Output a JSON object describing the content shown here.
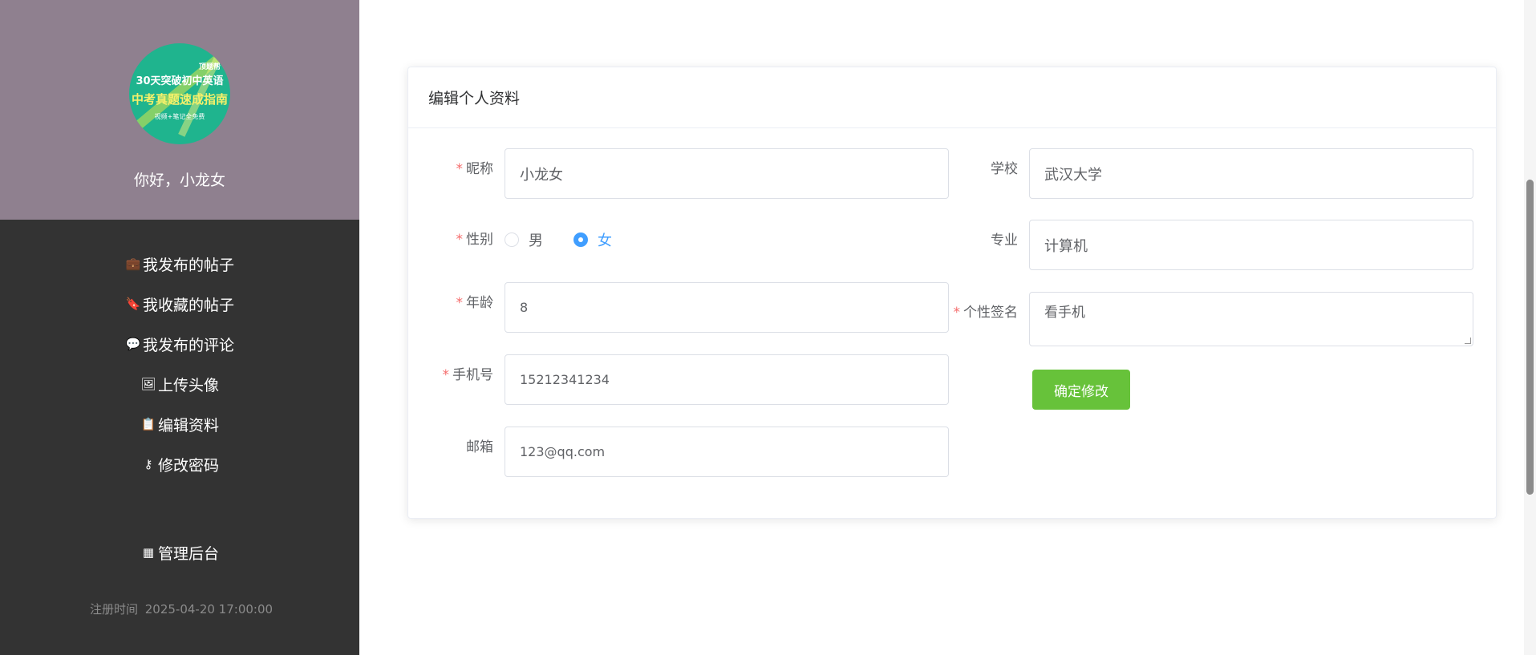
{
  "sidebar": {
    "avatar": {
      "line0": "顶题帮",
      "line1": "30天突破初中英语",
      "line2": "中考真题速成指南",
      "line3": "视频+笔记全免费"
    },
    "greeting": "你好，小龙女",
    "menu": [
      {
        "icon": "briefcase-icon",
        "label": "我发布的帖子"
      },
      {
        "icon": "bookmark-icon",
        "label": "我收藏的帖子"
      },
      {
        "icon": "comment-icon",
        "label": "我发布的评论"
      },
      {
        "icon": "image-icon",
        "label": "上传头像"
      },
      {
        "icon": "clipboard-icon",
        "label": "编辑资料"
      },
      {
        "icon": "key-icon",
        "label": "修改密码"
      }
    ],
    "admin": {
      "icon": "grid-icon",
      "label": "管理后台"
    },
    "register_label": "注册时间",
    "register_time": "2025-04-20 17:00:00"
  },
  "form": {
    "title": "编辑个人资料",
    "nickname": {
      "label": "昵称",
      "value": "小龙女",
      "required": true
    },
    "gender": {
      "label": "性别",
      "options": [
        "男",
        "女"
      ],
      "selected": "女",
      "required": true
    },
    "age": {
      "label": "年龄",
      "value": "8",
      "required": true
    },
    "phone": {
      "label": "手机号",
      "value": "15212341234",
      "required": true
    },
    "email": {
      "label": "邮箱",
      "value": "123@qq.com",
      "required": false
    },
    "school": {
      "label": "学校",
      "value": "武汉大学",
      "required": false
    },
    "major": {
      "label": "专业",
      "value": "计算机",
      "required": false
    },
    "signature": {
      "label": "个性签名",
      "value": "看手机",
      "required": true
    },
    "submit_label": "确定修改"
  },
  "colors": {
    "sidebar_bg": "#333333",
    "profile_bg": "#8f808f",
    "primary": "#409eff",
    "success": "#67c23a",
    "required": "#f56c6c"
  }
}
